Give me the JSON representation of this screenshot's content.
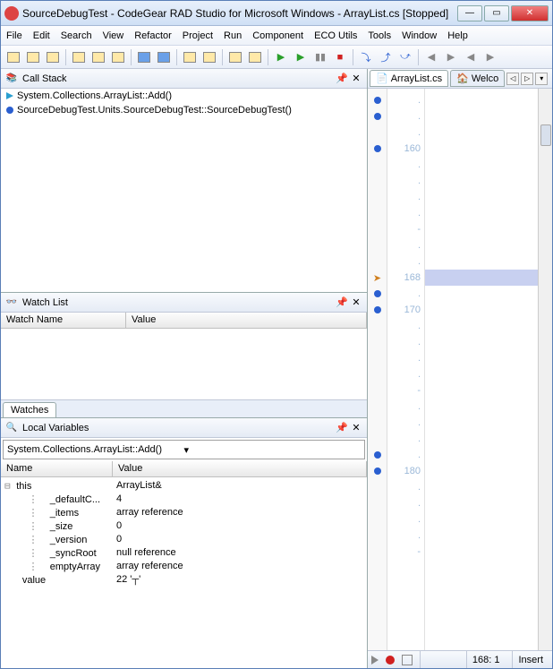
{
  "window": {
    "title": "SourceDebugTest - CodeGear RAD Studio for Microsoft Windows - ArrayList.cs [Stopped]"
  },
  "menu": [
    "File",
    "Edit",
    "Search",
    "View",
    "Refactor",
    "Project",
    "Run",
    "Component",
    "ECO Utils",
    "Tools",
    "Window",
    "Help"
  ],
  "callstack": {
    "title": "Call Stack",
    "items": [
      "System.Collections.ArrayList::Add()",
      "SourceDebugTest.Units.SourceDebugTest::SourceDebugTest()"
    ]
  },
  "watch": {
    "title": "Watch List",
    "cols": {
      "name": "Watch Name",
      "value": "Value"
    },
    "tab": "Watches"
  },
  "locals": {
    "title": "Local Variables",
    "context": "System.Collections.ArrayList::Add()",
    "cols": {
      "name": "Name",
      "value": "Value"
    },
    "rows": [
      {
        "indent": 0,
        "toggle": "-",
        "name": "this",
        "value": "ArrayList&"
      },
      {
        "indent": 1,
        "toggle": "",
        "name": "_defaultC...",
        "value": "4"
      },
      {
        "indent": 1,
        "toggle": "",
        "name": "_items",
        "value": "array reference"
      },
      {
        "indent": 1,
        "toggle": "",
        "name": "_size",
        "value": "0"
      },
      {
        "indent": 1,
        "toggle": "",
        "name": "_version",
        "value": "0"
      },
      {
        "indent": 1,
        "toggle": "",
        "name": "_syncRoot",
        "value": "null reference"
      },
      {
        "indent": 1,
        "toggle": "",
        "name": "emptyArray",
        "value": "array reference"
      },
      {
        "indent": 0,
        "toggle": "",
        "name": "value",
        "value": "22 '┬'"
      }
    ]
  },
  "editor": {
    "tabs": {
      "active": "ArrayList.cs",
      "inactive": "Welco"
    },
    "lines": [
      ".",
      ".",
      ".",
      "160",
      ".",
      ".",
      ".",
      ".",
      "-",
      ".",
      ".",
      "168",
      ".",
      "170",
      ".",
      ".",
      ".",
      ".",
      "-",
      ".",
      ".",
      ".",
      ".",
      "180",
      ".",
      ".",
      ".",
      ".",
      "-"
    ],
    "currentLineIdx": 11,
    "breakpoints": [
      0,
      1,
      3,
      11,
      12,
      13,
      22,
      23
    ]
  },
  "status": {
    "pos": "168: 1",
    "mode": "Insert"
  },
  "chart_data": null
}
